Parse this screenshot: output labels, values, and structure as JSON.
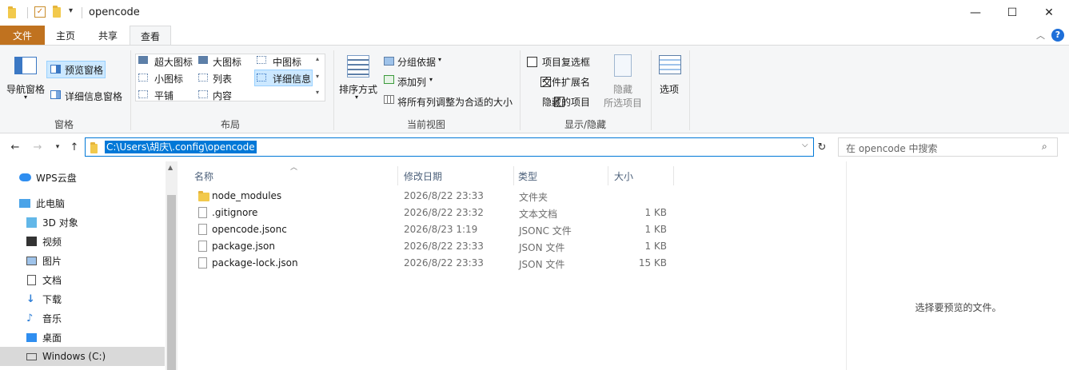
{
  "window": {
    "title": "opencode",
    "controls": {
      "minimize": "—",
      "maximize": "☐",
      "close": "✕"
    }
  },
  "ribbon_tabs": [
    {
      "label": "文件"
    },
    {
      "label": "主页"
    },
    {
      "label": "共享"
    },
    {
      "label": "查看"
    }
  ],
  "ribbon": {
    "panes": {
      "nav_pane": "导航窗格",
      "preview_pane": "预览窗格",
      "details_pane": "详细信息窗格",
      "group": "窗格"
    },
    "layout": {
      "items": [
        "超大图标",
        "大图标",
        "中图标",
        "小图标",
        "列表",
        "详细信息",
        "平铺",
        "内容"
      ],
      "group": "布局"
    },
    "current_view": {
      "sort": "排序方式",
      "group_by": "分组依据",
      "add_column": "添加列",
      "fit_columns": "将所有列调整为合适的大小",
      "group": "当前视图"
    },
    "show_hide": {
      "item_checkboxes": "项目复选框",
      "file_extensions": "文件扩展名",
      "hidden_items": "隐藏的项目",
      "hide_selected_line1": "隐藏",
      "hide_selected_line2": "所选项目",
      "options": "选项",
      "group": "显示/隐藏",
      "item_checkboxes_checked": false,
      "file_extensions_checked": true,
      "hidden_items_checked": true
    }
  },
  "address": {
    "path": "C:\\Users\\胡庆\\.config\\opencode",
    "search_placeholder": "在 opencode 中搜索"
  },
  "nav_pane": [
    {
      "label": "WPS云盘",
      "icon": "cloud-icon"
    },
    {
      "label": "此电脑",
      "icon": "computer-icon"
    },
    {
      "label": "3D 对象",
      "icon": "3d-objects-icon"
    },
    {
      "label": "视频",
      "icon": "video-icon"
    },
    {
      "label": "图片",
      "icon": "pictures-icon"
    },
    {
      "label": "文档",
      "icon": "documents-icon"
    },
    {
      "label": "下载",
      "icon": "download-icon"
    },
    {
      "label": "音乐",
      "icon": "music-icon"
    },
    {
      "label": "桌面",
      "icon": "desktop-icon"
    },
    {
      "label": "Windows (C:)",
      "icon": "drive-icon"
    }
  ],
  "columns": {
    "name": "名称",
    "modified": "修改日期",
    "type": "类型",
    "size": "大小"
  },
  "files": [
    {
      "name": "node_modules",
      "modified": "2026/8/22 23:33",
      "type": "文件夹",
      "size": "",
      "icon": "folder-icon"
    },
    {
      "name": ".gitignore",
      "modified": "2026/8/22 23:32",
      "type": "文本文档",
      "size": "1 KB",
      "icon": "text-file-icon"
    },
    {
      "name": "opencode.jsonc",
      "modified": "2026/8/23 1:19",
      "type": "JSONC 文件",
      "size": "1 KB",
      "icon": "file-icon"
    },
    {
      "name": "package.json",
      "modified": "2026/8/22 23:33",
      "type": "JSON 文件",
      "size": "1 KB",
      "icon": "file-icon"
    },
    {
      "name": "package-lock.json",
      "modified": "2026/8/22 23:33",
      "type": "JSON 文件",
      "size": "15 KB",
      "icon": "file-icon"
    }
  ],
  "preview": {
    "message": "选择要预览的文件。"
  },
  "colors": {
    "accent": "#0078d7",
    "file_tab": "#c0721f",
    "selection": "#cce8ff",
    "folder": "#f2c94c"
  }
}
